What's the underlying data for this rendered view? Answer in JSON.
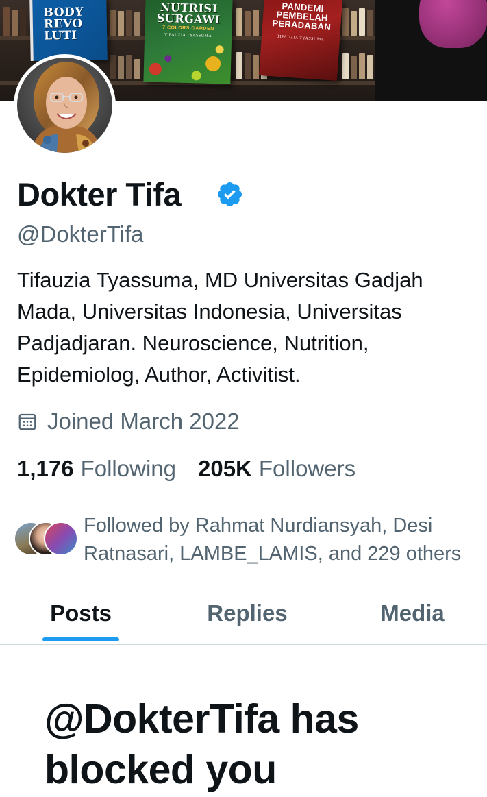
{
  "profile": {
    "display_name": "Dokter Tifa",
    "handle": "@DokterTifa",
    "verified": true,
    "bio": "Tifauzia Tyassuma, MD  Universitas Gadjah Mada,  Universitas Indonesia, Universitas Padjadjaran. Neuroscience, Nutrition, Epidemiolog, Author,  Activitist.",
    "joined": "Joined March 2022",
    "following_count": "1,176",
    "following_label": "Following",
    "followers_count": "205K",
    "followers_label": "Followers",
    "followed_by": "Followed by Rahmat Nurdiansyah, Desi Ratnasari, LAMBE_LAMIS, and 229 others"
  },
  "banner": {
    "books": [
      {
        "title": "BODY\nREVO\nLUTI"
      },
      {
        "title": "NUTRISI\nSURGAWI",
        "subtitle": "7 COLORS GARDEN",
        "author": "TIFAUZIA TYASSUMA"
      },
      {
        "title": "PANDEMI\nPEMBELAH\nPERADABAN",
        "author": "TIFAUZIA TYASSUMA"
      }
    ]
  },
  "tabs": [
    {
      "label": "Posts",
      "active": true
    },
    {
      "label": "Replies",
      "active": false
    },
    {
      "label": "Media",
      "active": false
    }
  ],
  "blocked_message": "@DokterTifa has blocked you",
  "colors": {
    "accent": "#1d9bf0",
    "verified": "#1d9bf0",
    "text_primary": "#0f1419",
    "text_secondary": "#536471"
  },
  "icons": {
    "verified": "verified-badge-icon",
    "joined": "calendar-icon"
  }
}
